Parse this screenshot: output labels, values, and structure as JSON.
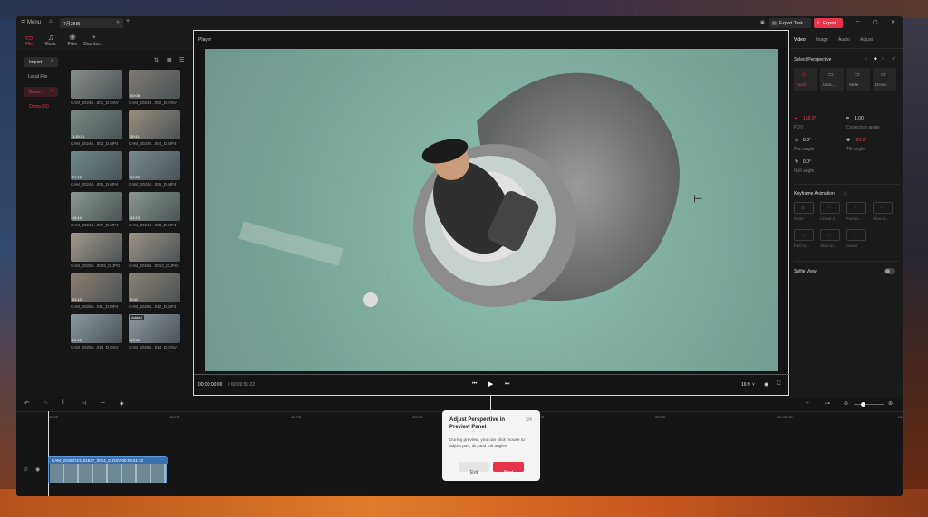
{
  "titlebar": {
    "menu": "Menu",
    "tab": "7月28日",
    "export_task": "Export Task",
    "export": "Export"
  },
  "left_tabs": [
    "File",
    "Music",
    "Filter",
    "Dashbo..."
  ],
  "sidebar": {
    "import": "Import",
    "local_file": "Local File",
    "device": "Devic...",
    "device_item": "Osmo360"
  },
  "media": [
    {
      "name": "CAM_20240...001_D.OSV",
      "badge": ""
    },
    {
      "name": "CAM_20240...002_D.OSV",
      "badge": "00:08"
    },
    {
      "name": "CAM_20240...003_D.MP4",
      "badge": "1:20:21"
    },
    {
      "name": "CAM_20240...004_D.MP4",
      "badge": "30:11"
    },
    {
      "name": "CAM_20240...005_D.MP4",
      "badge": "27:12"
    },
    {
      "name": "CAM_20240...006_D.MP4",
      "badge": "01:30"
    },
    {
      "name": "CAM_20240...007_D.MP4",
      "badge": "14:14"
    },
    {
      "name": "CAM_20240...008_D.MP4",
      "badge": "31:13"
    },
    {
      "name": "CAM_20250...0009_D.JPG",
      "badge": ""
    },
    {
      "name": "CAM_20250...0010_D.JPG",
      "badge": ""
    },
    {
      "name": "CAM_20250...011_D.MP4",
      "badge": "01:13"
    },
    {
      "name": "CAM_20250...012_D.MP4",
      "badge": "0:02"
    },
    {
      "name": "CAM_20250...013_D.OSV",
      "badge": "29:12"
    },
    {
      "name": "CAM_20250...014_D.OSV",
      "badge": "09:52",
      "added": "Added"
    }
  ],
  "player": {
    "title": "Player",
    "time_current": "00:00:00:00",
    "time_total": "/ 00:09:51:22",
    "aspect": "16:9"
  },
  "right_panel": {
    "tabs": [
      "Video",
      "Image",
      "Audio",
      "Adjust"
    ],
    "select_perspective": "Select Perspective",
    "perspectives": [
      "Autof...",
      "Ultra...",
      "Wide",
      "Deser..."
    ],
    "fov_value": "138.0°",
    "fov_label": "FOV",
    "correction_value": "1.00",
    "correction_label": "Correction angle",
    "pan_value": "0.0°",
    "pan_label": "Pan angle",
    "tilt_value": "-90.0°",
    "tilt_label": "Tilt angle",
    "roll_value": "0.0°",
    "roll_label": "Roll angle",
    "keyframe": "Keyframe Animation",
    "keyframes": [
      "None",
      "Linear s...",
      "Fast in...",
      "Slow in...",
      "Fast in...",
      "Slow in...",
      "Linear"
    ],
    "selfie": "Selfie View"
  },
  "timeline": {
    "ticks": [
      "00:00",
      "10:00",
      "20:00",
      "30:00",
      "40:00",
      "50:00",
      "01:00:00",
      "01:10"
    ],
    "clip": "CAM_20250721101637_0014_D.OSV  00:09:51:22"
  },
  "tooltip": {
    "title": "Adjust Perspective in Preview Panel",
    "step": "3/4",
    "body": "During preview, you can click mouse to adjust pan, tilt, and roll angles",
    "exit": "Exit",
    "next": "Next"
  },
  "colors": {
    "accent": "#e8344a",
    "panel": "#1a1a1a",
    "bg": "#121212"
  }
}
